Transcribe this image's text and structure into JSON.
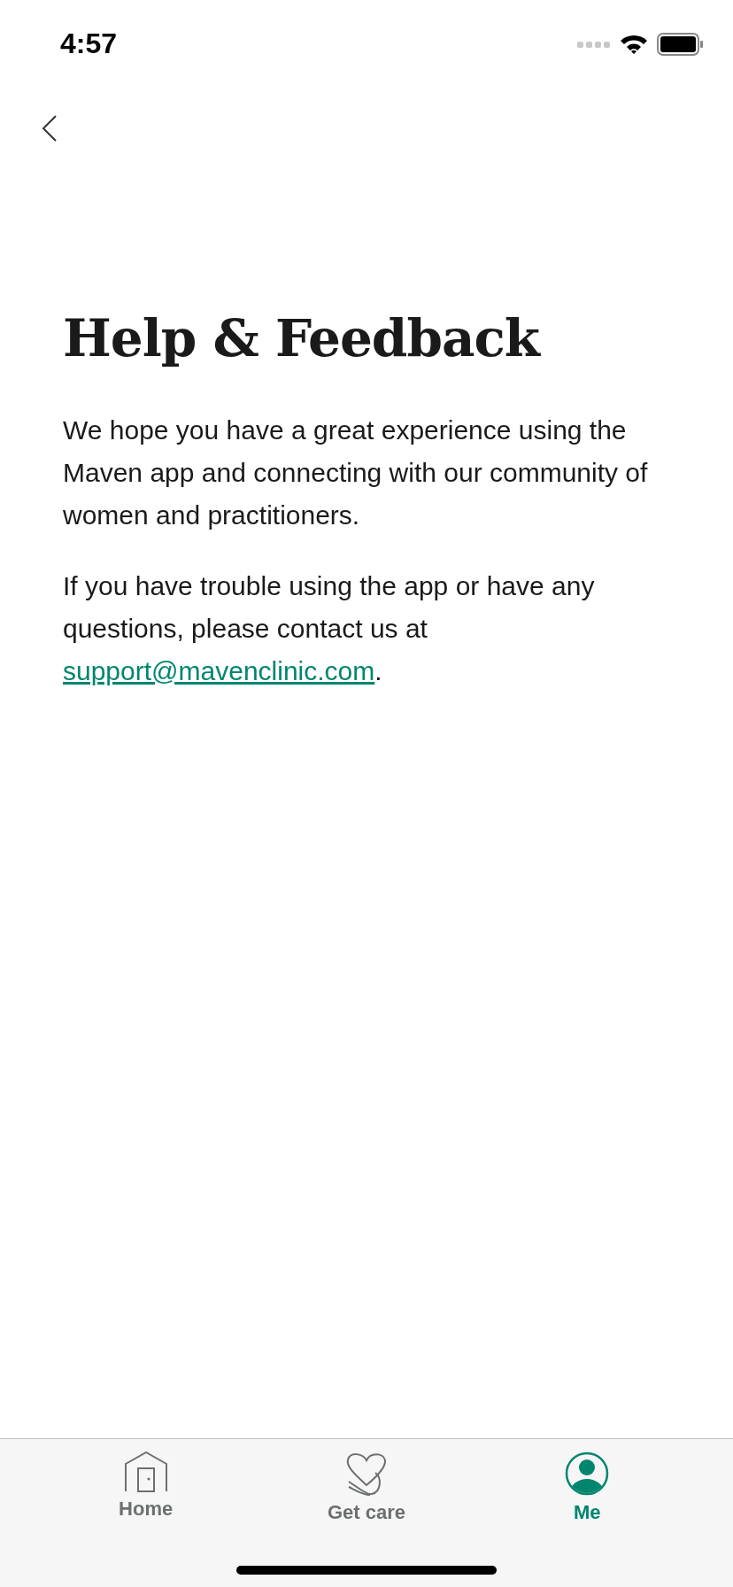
{
  "status_bar": {
    "time": "4:57"
  },
  "title": "Help & Feedback",
  "paragraphs": [
    {
      "text": "We hope you have a great experience using the Maven app and connecting with our community of women and practitioners."
    },
    {
      "text": "If you have trouble using the app or have any questions, please contact us at ",
      "link": "support@mavenclinic.com",
      "after": "."
    }
  ],
  "tabs": [
    {
      "kind": "home",
      "label": "Home",
      "selected": false
    },
    {
      "kind": "care",
      "label": "Get care",
      "selected": false
    },
    {
      "kind": "me",
      "label": "Me",
      "selected": true
    }
  ]
}
